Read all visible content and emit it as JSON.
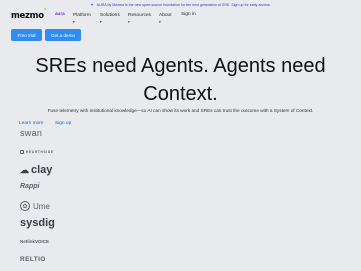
{
  "announcement": {
    "icon": "sparkle-icon",
    "text": "AURA by Mezmo is the new open-source foundation for the next generation of SRE. Sign up for early access."
  },
  "header": {
    "logo_text": "mezmo",
    "aura_label": "aura",
    "nav": [
      {
        "label": "Platform"
      },
      {
        "label": "Solutions"
      },
      {
        "label": "Resources"
      },
      {
        "label": "About"
      }
    ],
    "sign_in": "Sign in",
    "free_trial": "Free trial",
    "get_demo": "Get a demo"
  },
  "hero": {
    "title_line1": "SREs need Agents. Agents need",
    "title_line2": "Context.",
    "subtitle": "Fuse telemetry with institutional knowledge—so AI can show its work and SREs can trust the outcome with a System of Context.",
    "learn_more": "Learn more",
    "sign_up": "Sign up"
  },
  "customers": {
    "swan": "swan",
    "hearth": "HEARTHSIDE",
    "clay": "clay",
    "rappi": "Rappi",
    "ume": "Ume",
    "sysdig": "sysdig",
    "netlink": "NetlinkVOICE",
    "reltio": "RELTIO"
  },
  "colors": {
    "background": "#e9eaed",
    "primary_button": "#2f8cf0",
    "link": "#1f5fd8",
    "announcement": "#3b2fd1"
  }
}
